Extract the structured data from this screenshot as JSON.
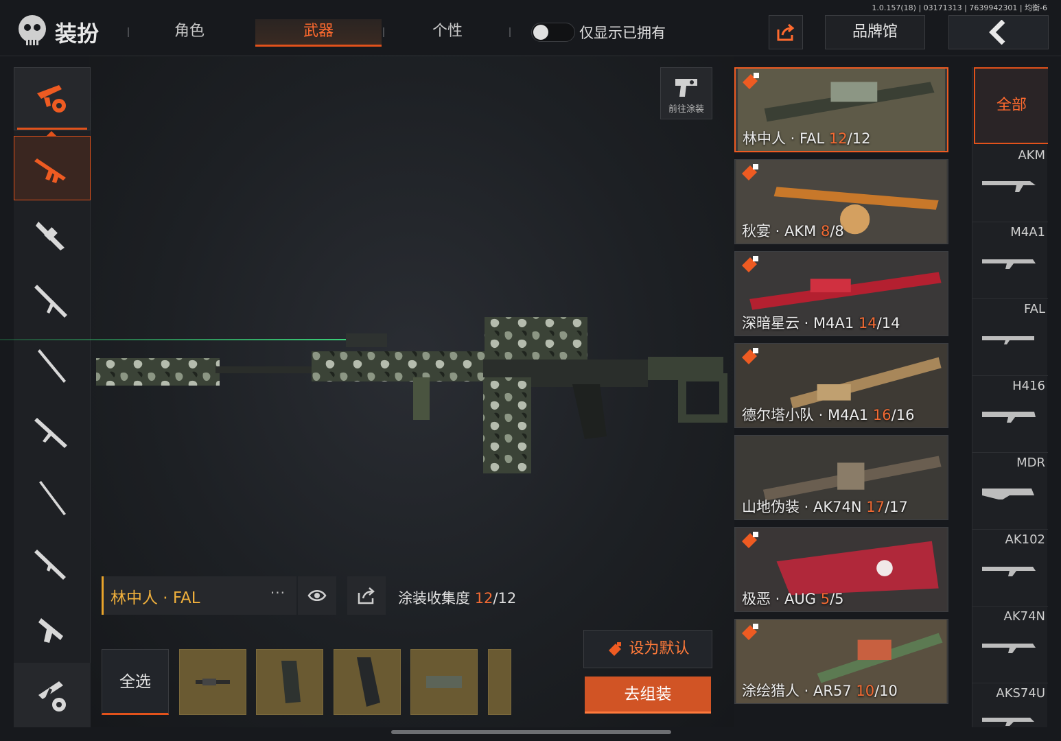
{
  "version": "1.0.157(18) | 03171313 | 7639942301 | 均衡-6",
  "header": {
    "title": "装扮",
    "tabs": [
      {
        "label": "角色"
      },
      {
        "label": "武器"
      },
      {
        "label": "个性"
      }
    ],
    "toggle_label": "仅显示已拥有",
    "brand_label": "品牌馆"
  },
  "display": {
    "goto_paint": "前往涂装",
    "skin_name": "林中人 · FAL",
    "more": "···",
    "collect_label": "涂装收集度 ",
    "collect_owned": "12",
    "collect_total": "/12"
  },
  "bottom": {
    "select_all": "全选",
    "set_default": "设为默认",
    "assemble": "去组装"
  },
  "skins": [
    {
      "name": "林中人 · FAL ",
      "owned": "12",
      "total": "/12"
    },
    {
      "name": "秋宴 · AKM ",
      "owned": "8",
      "total": "/8"
    },
    {
      "name": "深暗星云 · M4A1 ",
      "owned": "14",
      "total": "/14"
    },
    {
      "name": "德尔塔小队 · M4A1 ",
      "owned": "16",
      "total": "/16"
    },
    {
      "name": "山地伪装 · AK74N ",
      "owned": "17",
      "total": "/17"
    },
    {
      "name": "极恶 · AUG ",
      "owned": "5",
      "total": "/5"
    },
    {
      "name": "涂绘猎人 · AR57 ",
      "owned": "10",
      "total": "/10"
    }
  ],
  "filter": {
    "all": "全部",
    "items": [
      "AKM",
      "M4A1",
      "FAL",
      "H416",
      "MDR",
      "AK102",
      "AK74N",
      "AKS74U"
    ]
  },
  "colors": {
    "accent": "#e2521b",
    "owned_count": "#f26a33",
    "skin_name": "#f0b03c"
  },
  "icons": [
    "logo-skull-icon",
    "share-icon",
    "back-arrow-icon",
    "eye-icon",
    "paint-spray-icon"
  ]
}
